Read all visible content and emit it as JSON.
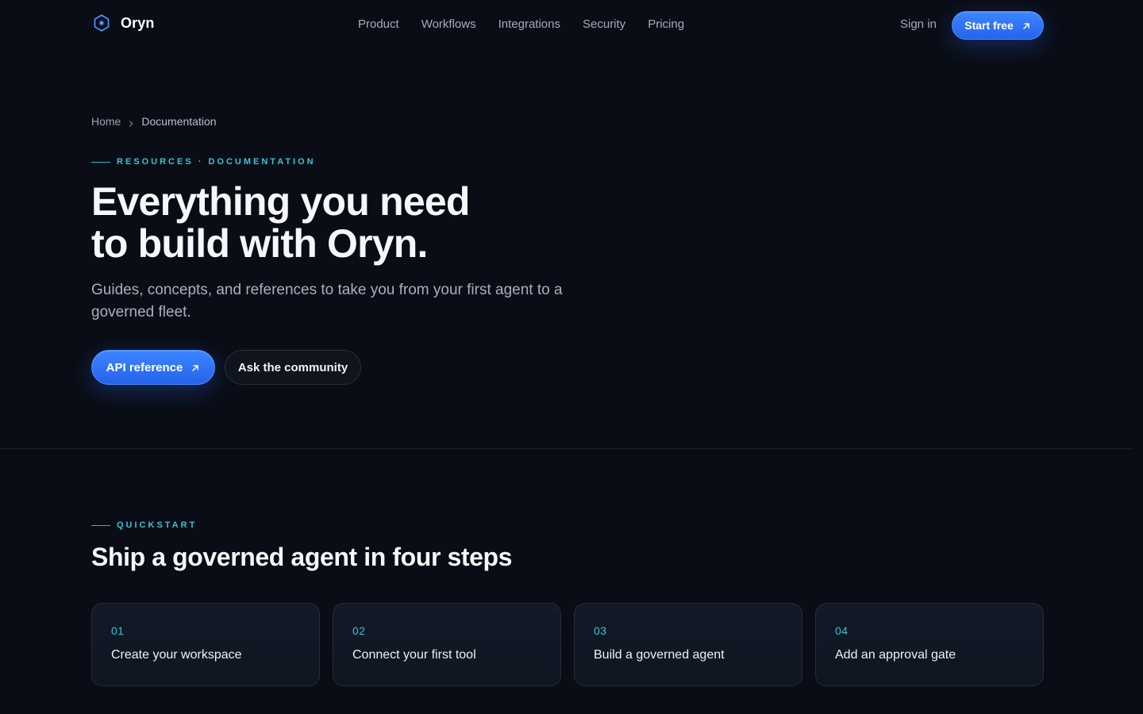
{
  "header": {
    "brand": "Oryn",
    "nav": [
      {
        "label": "Product"
      },
      {
        "label": "Workflows"
      },
      {
        "label": "Integrations"
      },
      {
        "label": "Security"
      },
      {
        "label": "Pricing"
      }
    ],
    "signin_label": "Sign in",
    "cta_label": "Start free"
  },
  "breadcrumb": {
    "home": "Home",
    "current": "Documentation"
  },
  "hero": {
    "eyebrow": "RESOURCES · DOCUMENTATION",
    "title_line1": "Everything you need",
    "title_line2": "to build with Oryn.",
    "subtitle": "Guides, concepts, and references to take you from your first agent to a governed fleet.",
    "primary_button": "API reference",
    "secondary_button": "Ask the community"
  },
  "quickstart": {
    "eyebrow": "QUICKSTART",
    "title": "Ship a governed agent in four steps",
    "steps": [
      {
        "num": "01",
        "title": "Create your workspace"
      },
      {
        "num": "02",
        "title": "Connect your first tool"
      },
      {
        "num": "03",
        "title": "Build a governed agent"
      },
      {
        "num": "04",
        "title": "Add an approval gate"
      }
    ]
  },
  "colors": {
    "background": "#0a0d15",
    "accent_blue": "#2f74f5",
    "accent_cyan": "#35c4d8"
  },
  "icons": [
    "hexagon-logo-icon",
    "arrow-up-right-icon",
    "chevron-right-icon"
  ]
}
